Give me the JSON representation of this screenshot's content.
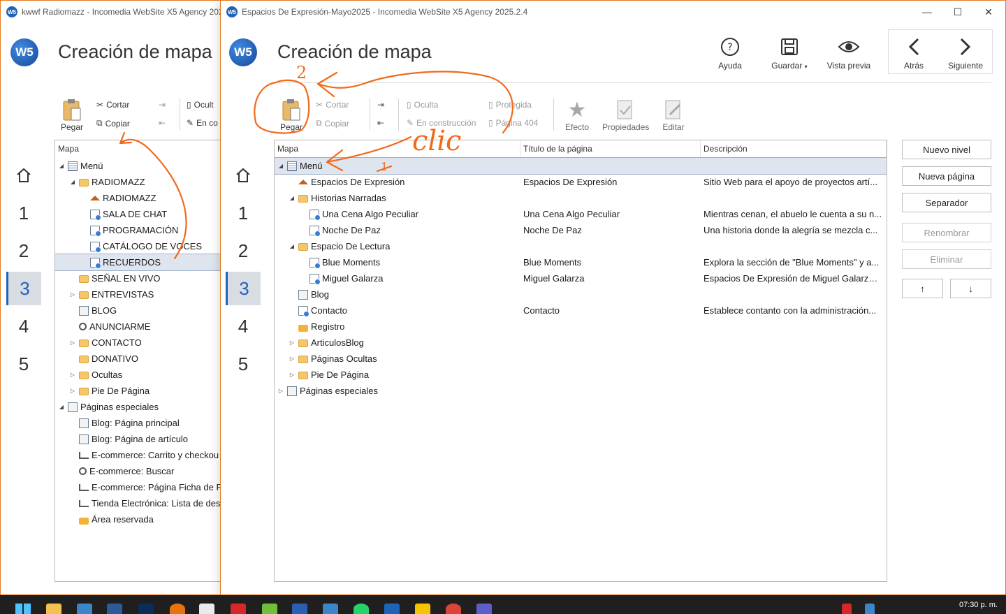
{
  "back_window": {
    "title": "kwwf Radiomazz - Incomedia WebSite X5 Agency 202",
    "heading": "Creación de mapa",
    "toolbar": {
      "paste": "Pegar",
      "cut": "Cortar",
      "copy": "Copiar",
      "hidden": "Ocult",
      "construction": "En co"
    },
    "steps": [
      "1",
      "2",
      "3",
      "4",
      "5"
    ],
    "tree_header": "Mapa",
    "tree": [
      {
        "label": "Menú",
        "icon": "menu-icon",
        "level": 0,
        "expander": "open"
      },
      {
        "label": "RADIOMAZZ",
        "icon": "folder-icon",
        "level": 1,
        "expander": "open"
      },
      {
        "label": "RADIOMAZZ",
        "icon": "home-icon",
        "level": 2
      },
      {
        "label": "SALA DE CHAT",
        "icon": "page-icon",
        "level": 2
      },
      {
        "label": "PROGRAMACIÓN",
        "icon": "page-icon",
        "level": 2
      },
      {
        "label": "CATÁLOGO DE VOCES",
        "icon": "page-icon",
        "level": 2
      },
      {
        "label": "RECUERDOS",
        "icon": "page-icon",
        "level": 2,
        "selected": true
      },
      {
        "label": "SEÑAL EN VIVO",
        "icon": "folder-icon",
        "level": 1
      },
      {
        "label": "ENTREVISTAS",
        "icon": "folder-icon",
        "level": 1,
        "expander": "closed"
      },
      {
        "label": "BLOG",
        "icon": "special-icon",
        "level": 1
      },
      {
        "label": "ANUNCIARME",
        "icon": "search-icon",
        "level": 1
      },
      {
        "label": "CONTACTO",
        "icon": "folder-icon",
        "level": 1,
        "expander": "closed"
      },
      {
        "label": "DONATIVO",
        "icon": "folder-icon",
        "level": 1
      },
      {
        "label": "Ocultas",
        "icon": "folder-icon",
        "level": 1,
        "expander": "closed"
      },
      {
        "label": "Pie De Página",
        "icon": "folder-icon",
        "level": 1,
        "expander": "closed"
      },
      {
        "label": "Páginas especiales",
        "icon": "special-icon",
        "level": 0,
        "expander": "open"
      },
      {
        "label": "Blog: Página principal",
        "icon": "special-icon",
        "level": 1
      },
      {
        "label": "Blog: Página de artículo",
        "icon": "special-icon",
        "level": 1
      },
      {
        "label": "E-commerce: Carrito y checkou",
        "icon": "cart-icon",
        "level": 1
      },
      {
        "label": "E-commerce: Buscar",
        "icon": "search-icon",
        "level": 1
      },
      {
        "label": "E-commerce: Página Ficha de P",
        "icon": "cart-icon",
        "level": 1
      },
      {
        "label": "Tienda Electrónica: Lista de des",
        "icon": "cart-icon",
        "level": 1
      },
      {
        "label": "Área reservada",
        "icon": "lock-icon",
        "level": 1
      }
    ]
  },
  "front_window": {
    "title": "Espacios De Expresión-Mayo2025 - Incomedia WebSite X5 Agency 2025.2.4",
    "heading": "Creación de mapa",
    "nav": {
      "help": "Ayuda",
      "save": "Guardar",
      "preview": "Vista previa",
      "back": "Atrás",
      "next": "Siguiente"
    },
    "toolbar": {
      "paste": "Pegar",
      "cut": "Cortar",
      "copy": "Copiar",
      "hidden": "Oculta",
      "construction": "En construcción",
      "protected": "Protegida",
      "page404": "Página 404",
      "effect": "Efecto",
      "properties": "Propiedades",
      "edit": "Editar"
    },
    "steps": [
      "1",
      "2",
      "3",
      "4",
      "5"
    ],
    "columns": {
      "map": "Mapa",
      "title": "Título de la página",
      "description": "Descripción"
    },
    "tree": [
      {
        "label": "Menú",
        "icon": "menu-icon",
        "level": 0,
        "expander": "open",
        "selected": true,
        "title": "",
        "description": ""
      },
      {
        "label": "Espacios De Expresión",
        "icon": "home-icon",
        "level": 1,
        "title": "Espacios De Expresión",
        "description": "Sitio Web para el apoyo de proyectos artí..."
      },
      {
        "label": "Historias Narradas",
        "icon": "folder-icon",
        "level": 1,
        "expander": "open",
        "title": "",
        "description": ""
      },
      {
        "label": "Una Cena Algo Peculiar",
        "icon": "page-icon",
        "level": 2,
        "title": "Una Cena Algo Peculiar",
        "description": "Mientras cenan, el abuelo le cuenta a su n..."
      },
      {
        "label": "Noche De Paz",
        "icon": "page-icon",
        "level": 2,
        "title": "Noche De Paz",
        "description": "Una historia donde la alegría se mezcla c..."
      },
      {
        "label": "Espacio De Lectura",
        "icon": "folder-icon",
        "level": 1,
        "expander": "open",
        "title": "",
        "description": ""
      },
      {
        "label": "Blue Moments",
        "icon": "page-icon",
        "level": 2,
        "title": "Blue Moments",
        "description": "Explora la sección de \"Blue Moments\" y a..."
      },
      {
        "label": "Miguel Galarza",
        "icon": "page-icon",
        "level": 2,
        "title": "Miguel Galarza",
        "description": "Espacios De Expresión de Miguel Galarza...."
      },
      {
        "label": "Blog",
        "icon": "special-icon",
        "level": 1,
        "title": "",
        "description": ""
      },
      {
        "label": "Contacto",
        "icon": "page-icon",
        "level": 1,
        "title": "Contacto",
        "description": "Establece contanto con la administración..."
      },
      {
        "label": "Registro",
        "icon": "lock-icon",
        "level": 1,
        "title": "",
        "description": ""
      },
      {
        "label": "ArticulosBlog",
        "icon": "folder-icon",
        "level": 1,
        "expander": "closed",
        "title": "",
        "description": ""
      },
      {
        "label": "Páginas Ocultas",
        "icon": "folder-icon",
        "level": 1,
        "expander": "closed",
        "title": "",
        "description": ""
      },
      {
        "label": "Pie De Página",
        "icon": "folder-icon",
        "level": 1,
        "expander": "closed",
        "title": "",
        "description": ""
      },
      {
        "label": "Páginas especiales",
        "icon": "special-icon",
        "level": 0,
        "expander": "closed",
        "title": "",
        "description": ""
      }
    ],
    "side_buttons": {
      "new_level": "Nuevo nivel",
      "new_page": "Nueva página",
      "separator": "Separador",
      "rename": "Renombrar",
      "delete": "Eliminar",
      "up": "↑",
      "down": "↓"
    }
  },
  "annotations": {
    "step_2": "2",
    "click": "clic",
    "step_1": "1",
    "color": "#f06a1a"
  },
  "taskbar": {
    "clock": "07:30 p. m."
  }
}
